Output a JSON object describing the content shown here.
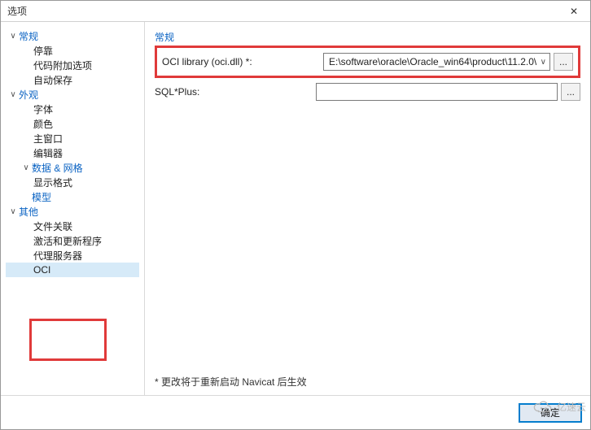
{
  "titlebar": {
    "title": "选项",
    "close": "✕"
  },
  "sidebar": {
    "nodes": {
      "general": "常规",
      "dock": "停靠",
      "codeaddon": "代码附加选项",
      "autosave": "自动保存",
      "appearance": "外观",
      "font": "字体",
      "color": "颜色",
      "mainwin": "主窗口",
      "editor": "编辑器",
      "datagrid": "数据 & 网格",
      "displayfmt": "显示格式",
      "model": "模型",
      "other": "其他",
      "fileassoc": "文件关联",
      "activation": "激活和更新程序",
      "proxy": "代理服务器",
      "oci": "OCI"
    }
  },
  "main": {
    "section_title": "常规",
    "oci_label": "OCI library (oci.dll) *:",
    "oci_value": "E:\\software\\oracle\\Oracle_win64\\product\\11.2.0\\",
    "sqlplus_label": "SQL*Plus:",
    "sqlplus_value": "",
    "browse": "...",
    "note": "* 更改将于重新启动 Navicat 后生效"
  },
  "footer": {
    "ok": "确定"
  },
  "watermark": "亿速云"
}
